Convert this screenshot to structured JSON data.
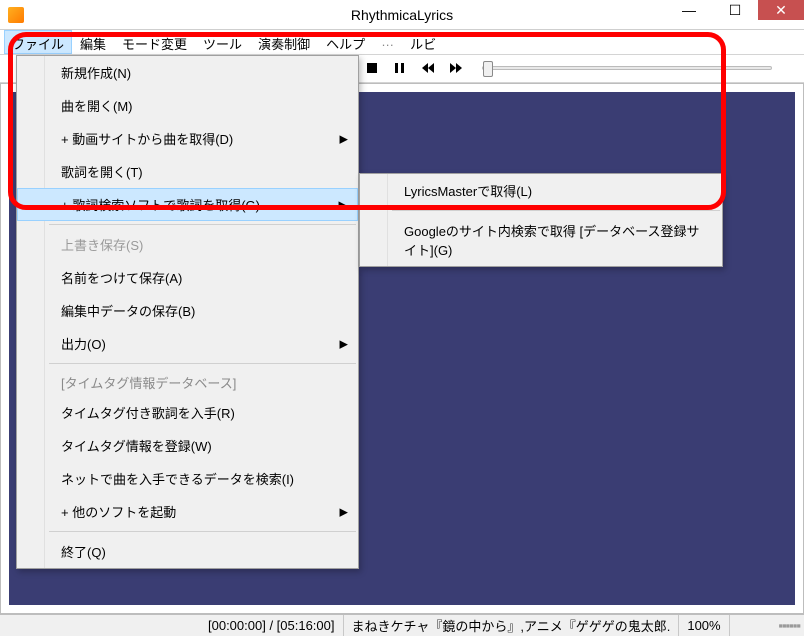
{
  "window": {
    "title": "RhythmicaLyrics"
  },
  "menubar": {
    "items": [
      "ファイル",
      "編集",
      "モード変更",
      "ツール",
      "演奏制御",
      "ヘルプ",
      "…",
      "ルビ"
    ]
  },
  "file_menu": {
    "items": [
      {
        "label": "新規作成(N)"
      },
      {
        "label": "曲を開く(M)"
      },
      {
        "label": "+ 動画サイトから曲を取得(D)",
        "submenu": true
      },
      {
        "label": "歌詞を開く(T)"
      },
      {
        "label": "+ 歌詞検索ソフトで歌詞を取得(G)",
        "submenu": true,
        "hover": true
      }
    ],
    "save_items": [
      {
        "label": "上書き保存(S)",
        "disabled": true
      },
      {
        "label": "名前をつけて保存(A)"
      },
      {
        "label": "編集中データの保存(B)"
      },
      {
        "label": "出力(O)",
        "submenu": true
      }
    ],
    "db_header": "[タイムタグ情報データベース]",
    "db_items": [
      {
        "label": "タイムタグ付き歌詞を入手(R)"
      },
      {
        "label": "タイムタグ情報を登録(W)"
      },
      {
        "label": "ネットで曲を入手できるデータを検索(I)"
      },
      {
        "label": "+ 他のソフトを起動",
        "submenu": true
      }
    ],
    "exit": {
      "label": "終了(Q)"
    }
  },
  "submenu": {
    "items": [
      {
        "label": "LyricsMasterで取得(L)"
      },
      {
        "label": "Googleのサイト内検索で取得 [データベース登録サイト](G)"
      }
    ]
  },
  "player": {
    "buttons": [
      "stop",
      "pause",
      "rewind",
      "fastforward"
    ]
  },
  "statusbar": {
    "time": "[00:00:00] / [05:16:00]",
    "info": "まねきケチャ『鏡の中から』,アニメ『ゲゲゲの鬼太郎.",
    "zoom": "100%"
  },
  "colors": {
    "accent_bg": "#f0c070",
    "canvas": "#3a3d73",
    "hover": "#cce8ff",
    "close": "#c75050",
    "highlight": "#ff0000"
  }
}
